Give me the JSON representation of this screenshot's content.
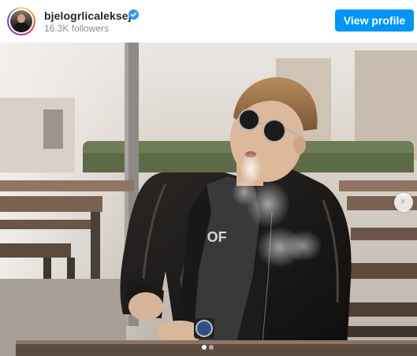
{
  "profile": {
    "username": "bjelogrlicaleksej",
    "followers": "16.3K followers",
    "verified": true,
    "button_label": "View profile",
    "avatar_icon": "profile-avatar"
  },
  "post": {
    "shirt_text": "Y OF",
    "carousel": {
      "current": 1,
      "total": 2,
      "next_icon": "chevron-right-icon"
    }
  },
  "colors": {
    "brand_blue": "#0095f6",
    "verified_blue": "#3897f0",
    "muted_text": "#8e8e8e"
  }
}
